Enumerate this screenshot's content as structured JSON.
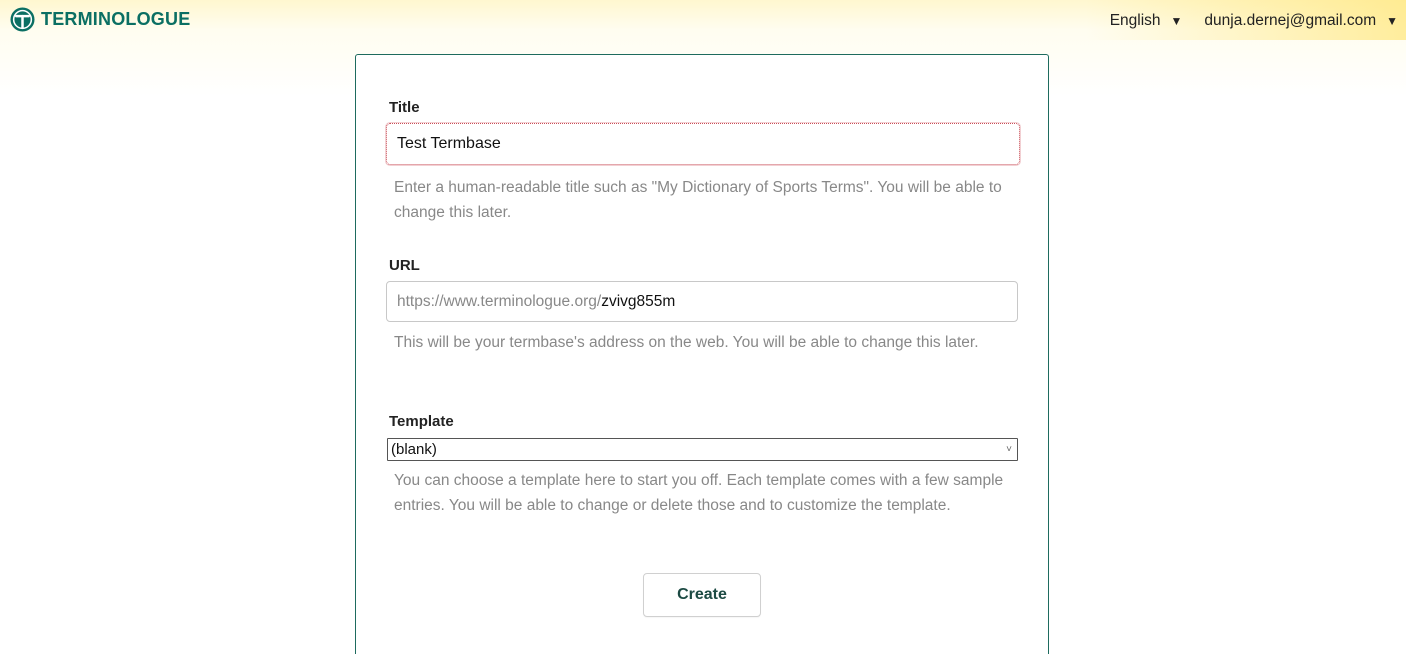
{
  "app": {
    "logo_text": "TERMINOLOGUE",
    "brand_color": "#0b6f63"
  },
  "topnav": {
    "language": "English",
    "user_email": "dunja.dernej@gmail.com",
    "caret_icon": "caret-down-icon"
  },
  "form": {
    "title": {
      "label": "Title",
      "value": "Test Termbase",
      "help": "Enter a human-readable title such as \"My Dictionary of Sports Terms\". You will be able to change this later."
    },
    "url": {
      "label": "URL",
      "prefix": "https://www.terminologue.org/",
      "value": "zvivg855m",
      "help": "This will be your termbase's address on the web. You will be able to change this later."
    },
    "template": {
      "label": "Template",
      "selected": "(blank)",
      "help": "You can choose a template here to start you off. Each template comes with a few sample entries. You will be able to change or delete those and to customize the template."
    },
    "create_label": "Create"
  }
}
